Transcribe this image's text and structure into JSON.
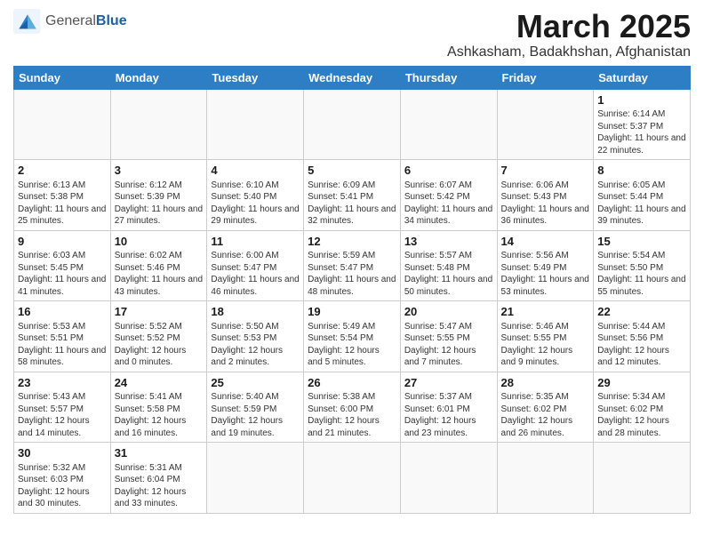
{
  "header": {
    "logo_general": "General",
    "logo_blue": "Blue",
    "month_title": "March 2025",
    "location": "Ashkasham, Badakhshan, Afghanistan"
  },
  "weekdays": [
    "Sunday",
    "Monday",
    "Tuesday",
    "Wednesday",
    "Thursday",
    "Friday",
    "Saturday"
  ],
  "weeks": [
    [
      {
        "day": "",
        "info": ""
      },
      {
        "day": "",
        "info": ""
      },
      {
        "day": "",
        "info": ""
      },
      {
        "day": "",
        "info": ""
      },
      {
        "day": "",
        "info": ""
      },
      {
        "day": "",
        "info": ""
      },
      {
        "day": "1",
        "info": "Sunrise: 6:14 AM\nSunset: 5:37 PM\nDaylight: 11 hours\nand 22 minutes."
      }
    ],
    [
      {
        "day": "2",
        "info": "Sunrise: 6:13 AM\nSunset: 5:38 PM\nDaylight: 11 hours\nand 25 minutes."
      },
      {
        "day": "3",
        "info": "Sunrise: 6:12 AM\nSunset: 5:39 PM\nDaylight: 11 hours\nand 27 minutes."
      },
      {
        "day": "4",
        "info": "Sunrise: 6:10 AM\nSunset: 5:40 PM\nDaylight: 11 hours\nand 29 minutes."
      },
      {
        "day": "5",
        "info": "Sunrise: 6:09 AM\nSunset: 5:41 PM\nDaylight: 11 hours\nand 32 minutes."
      },
      {
        "day": "6",
        "info": "Sunrise: 6:07 AM\nSunset: 5:42 PM\nDaylight: 11 hours\nand 34 minutes."
      },
      {
        "day": "7",
        "info": "Sunrise: 6:06 AM\nSunset: 5:43 PM\nDaylight: 11 hours\nand 36 minutes."
      },
      {
        "day": "8",
        "info": "Sunrise: 6:05 AM\nSunset: 5:44 PM\nDaylight: 11 hours\nand 39 minutes."
      }
    ],
    [
      {
        "day": "9",
        "info": "Sunrise: 6:03 AM\nSunset: 5:45 PM\nDaylight: 11 hours\nand 41 minutes."
      },
      {
        "day": "10",
        "info": "Sunrise: 6:02 AM\nSunset: 5:46 PM\nDaylight: 11 hours\nand 43 minutes."
      },
      {
        "day": "11",
        "info": "Sunrise: 6:00 AM\nSunset: 5:47 PM\nDaylight: 11 hours\nand 46 minutes."
      },
      {
        "day": "12",
        "info": "Sunrise: 5:59 AM\nSunset: 5:47 PM\nDaylight: 11 hours\nand 48 minutes."
      },
      {
        "day": "13",
        "info": "Sunrise: 5:57 AM\nSunset: 5:48 PM\nDaylight: 11 hours\nand 50 minutes."
      },
      {
        "day": "14",
        "info": "Sunrise: 5:56 AM\nSunset: 5:49 PM\nDaylight: 11 hours\nand 53 minutes."
      },
      {
        "day": "15",
        "info": "Sunrise: 5:54 AM\nSunset: 5:50 PM\nDaylight: 11 hours\nand 55 minutes."
      }
    ],
    [
      {
        "day": "16",
        "info": "Sunrise: 5:53 AM\nSunset: 5:51 PM\nDaylight: 11 hours\nand 58 minutes."
      },
      {
        "day": "17",
        "info": "Sunrise: 5:52 AM\nSunset: 5:52 PM\nDaylight: 12 hours\nand 0 minutes."
      },
      {
        "day": "18",
        "info": "Sunrise: 5:50 AM\nSunset: 5:53 PM\nDaylight: 12 hours\nand 2 minutes."
      },
      {
        "day": "19",
        "info": "Sunrise: 5:49 AM\nSunset: 5:54 PM\nDaylight: 12 hours\nand 5 minutes."
      },
      {
        "day": "20",
        "info": "Sunrise: 5:47 AM\nSunset: 5:55 PM\nDaylight: 12 hours\nand 7 minutes."
      },
      {
        "day": "21",
        "info": "Sunrise: 5:46 AM\nSunset: 5:55 PM\nDaylight: 12 hours\nand 9 minutes."
      },
      {
        "day": "22",
        "info": "Sunrise: 5:44 AM\nSunset: 5:56 PM\nDaylight: 12 hours\nand 12 minutes."
      }
    ],
    [
      {
        "day": "23",
        "info": "Sunrise: 5:43 AM\nSunset: 5:57 PM\nDaylight: 12 hours\nand 14 minutes."
      },
      {
        "day": "24",
        "info": "Sunrise: 5:41 AM\nSunset: 5:58 PM\nDaylight: 12 hours\nand 16 minutes."
      },
      {
        "day": "25",
        "info": "Sunrise: 5:40 AM\nSunset: 5:59 PM\nDaylight: 12 hours\nand 19 minutes."
      },
      {
        "day": "26",
        "info": "Sunrise: 5:38 AM\nSunset: 6:00 PM\nDaylight: 12 hours\nand 21 minutes."
      },
      {
        "day": "27",
        "info": "Sunrise: 5:37 AM\nSunset: 6:01 PM\nDaylight: 12 hours\nand 23 minutes."
      },
      {
        "day": "28",
        "info": "Sunrise: 5:35 AM\nSunset: 6:02 PM\nDaylight: 12 hours\nand 26 minutes."
      },
      {
        "day": "29",
        "info": "Sunrise: 5:34 AM\nSunset: 6:02 PM\nDaylight: 12 hours\nand 28 minutes."
      }
    ],
    [
      {
        "day": "30",
        "info": "Sunrise: 5:32 AM\nSunset: 6:03 PM\nDaylight: 12 hours\nand 30 minutes."
      },
      {
        "day": "31",
        "info": "Sunrise: 5:31 AM\nSunset: 6:04 PM\nDaylight: 12 hours\nand 33 minutes."
      },
      {
        "day": "",
        "info": ""
      },
      {
        "day": "",
        "info": ""
      },
      {
        "day": "",
        "info": ""
      },
      {
        "day": "",
        "info": ""
      },
      {
        "day": "",
        "info": ""
      }
    ]
  ]
}
